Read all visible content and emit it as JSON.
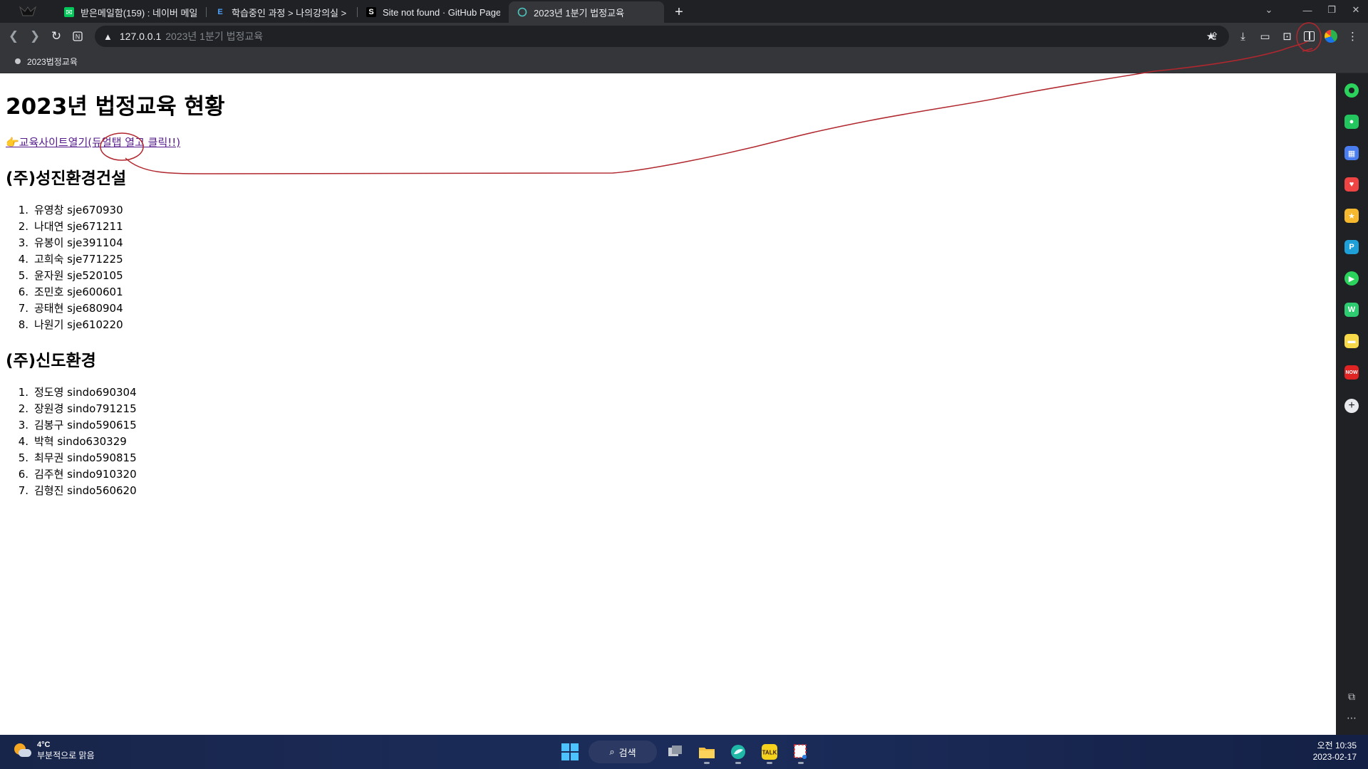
{
  "browser": {
    "tabs": [
      {
        "label": "받은메일함(159) : 네이버 메일",
        "icon": "naver-mail-icon",
        "active": false
      },
      {
        "label": "학습중인 과정 > 나의강의실 > 과정상세",
        "icon": "elearning-icon",
        "active": false
      },
      {
        "label": "Site not found · GitHub Pages",
        "icon": "github-icon",
        "active": false
      },
      {
        "label": "2023년 1분기 법정교육",
        "icon": "globe-icon",
        "active": true
      }
    ],
    "new_tab_label": "+",
    "address": {
      "host": "127.0.0.1",
      "title": "2023년 1분기 법정교육"
    },
    "bookmarks": [
      {
        "label": "2023법정교육"
      }
    ]
  },
  "page": {
    "title": "2023년 법정교육 현황",
    "link_text": "👉교육사이트열기(듀얼탭 열고 클릭!!)",
    "companies": [
      {
        "name": "(주)성진환경건설",
        "members": [
          {
            "num": "1.",
            "text": "유영창 sje670930"
          },
          {
            "num": "2.",
            "text": "나대연 sje671211"
          },
          {
            "num": "3.",
            "text": "유봉이 sje391104"
          },
          {
            "num": "4.",
            "text": "고희숙 sje771225"
          },
          {
            "num": "5.",
            "text": "윤자원 sje520105"
          },
          {
            "num": "6.",
            "text": "조민호 sje600601"
          },
          {
            "num": "7.",
            "text": "공태현 sje680904"
          },
          {
            "num": "8.",
            "text": "나원기 sje610220"
          }
        ]
      },
      {
        "name": "(주)신도환경",
        "members": [
          {
            "num": "1.",
            "text": "정도영 sindo690304"
          },
          {
            "num": "2.",
            "text": "장원경 sindo791215"
          },
          {
            "num": "3.",
            "text": "김봉구 sindo590615"
          },
          {
            "num": "4.",
            "text": "박혁 sindo630329"
          },
          {
            "num": "5.",
            "text": "최무권 sindo590815"
          },
          {
            "num": "6.",
            "text": "김주현 sindo910320"
          },
          {
            "num": "7.",
            "text": "김형진 sindo560620"
          }
        ]
      }
    ]
  },
  "taskbar": {
    "weather": {
      "temp": "4°C",
      "desc": "부분적으로 맑음"
    },
    "search_label": "검색",
    "clock": {
      "time": "오전 10:35",
      "date": "2023-02-17"
    }
  },
  "colors": {
    "link": "#551a8b",
    "annotation": "#b1272e",
    "accent_blue": "#4cc2ff"
  }
}
